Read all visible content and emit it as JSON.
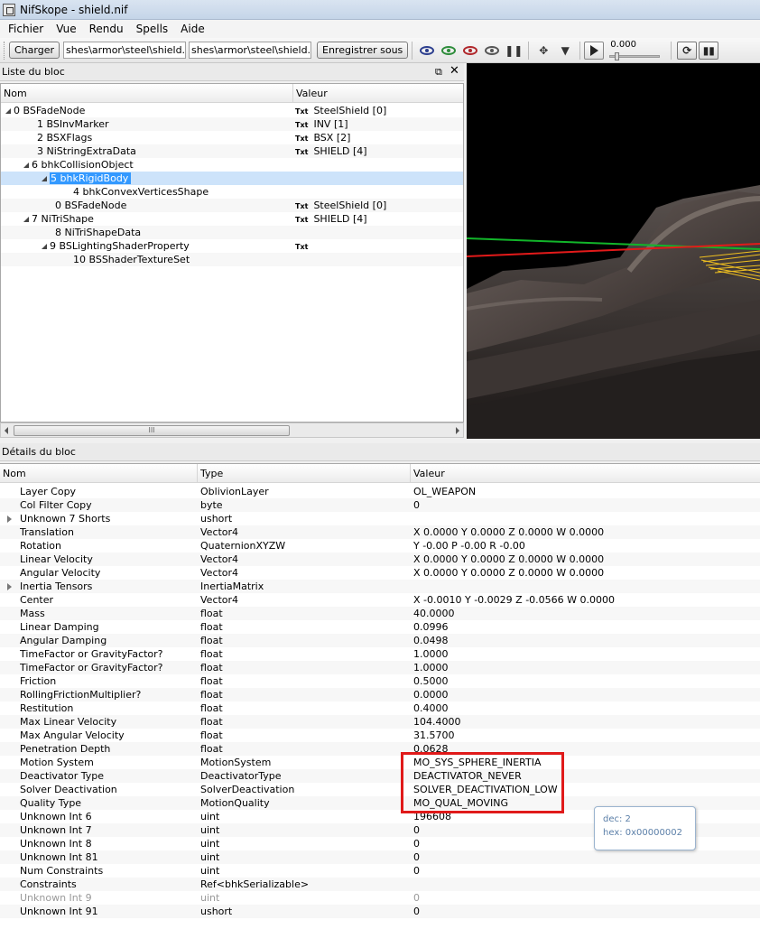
{
  "window": {
    "title": "NifSkope - shield.nif"
  },
  "menu": [
    "Fichier",
    "Vue",
    "Rendu",
    "Spells",
    "Aide"
  ],
  "toolbar": {
    "load_label": "Charger",
    "load_path": "shes\\armor\\steel\\shield.nif",
    "save_path": "shes\\armor\\steel\\shield.nif",
    "save_label": "Enregistrer sous",
    "time_value": "0.000"
  },
  "block_list": {
    "title": "Liste du bloc",
    "columns": [
      "Nom",
      "Valeur"
    ],
    "rows": [
      {
        "label": "0 BSFadeNode",
        "value": "SteelShield [0]",
        "txt": "Txt",
        "indent": 0,
        "arrow": "open"
      },
      {
        "label": "1 BSInvMarker",
        "value": "INV [1]",
        "txt": "Txt",
        "indent": 1,
        "arrow": "none"
      },
      {
        "label": "2 BSXFlags",
        "value": "BSX [2]",
        "txt": "Txt",
        "indent": 1,
        "arrow": "none"
      },
      {
        "label": "3 NiStringExtraData",
        "value": "SHIELD [4]",
        "txt": "Txt",
        "indent": 1,
        "arrow": "none"
      },
      {
        "label": "6 bhkCollisionObject",
        "value": "",
        "txt": "",
        "indent": 1,
        "arrow": "open"
      },
      {
        "label": "5 bhkRigidBody",
        "value": "",
        "txt": "",
        "indent": 2,
        "arrow": "open",
        "selected": true
      },
      {
        "label": "4 bhkConvexVerticesShape",
        "value": "",
        "txt": "",
        "indent": 3,
        "arrow": "none"
      },
      {
        "label": "0 BSFadeNode",
        "value": "SteelShield [0]",
        "txt": "Txt",
        "indent": 2,
        "arrow": "none"
      },
      {
        "label": "7 NiTriShape",
        "value": "SHIELD [4]",
        "txt": "Txt",
        "indent": 1,
        "arrow": "open"
      },
      {
        "label": "8 NiTriShapeData",
        "value": "",
        "txt": "",
        "indent": 2,
        "arrow": "none"
      },
      {
        "label": "9 BSLightingShaderProperty",
        "value": "",
        "txt": "Txt",
        "indent": 2,
        "arrow": "open"
      },
      {
        "label": "10 BSShaderTextureSet",
        "value": "",
        "txt": "",
        "indent": 3,
        "arrow": "none"
      }
    ]
  },
  "scroll_grip": "III",
  "details": {
    "title": "Détails du bloc",
    "columns": [
      "Nom",
      "Type",
      "Valeur"
    ],
    "rows": [
      {
        "name": "Layer Copy",
        "type": "OblivionLayer",
        "value": "OL_WEAPON"
      },
      {
        "name": "Col Filter Copy",
        "type": "byte",
        "value": "0"
      },
      {
        "name": "Unknown 7 Shorts",
        "type": "ushort",
        "value": "",
        "expandable": true
      },
      {
        "name": "Translation",
        "type": "Vector4",
        "value": "X 0.0000 Y 0.0000 Z 0.0000 W 0.0000"
      },
      {
        "name": "Rotation",
        "type": "QuaternionXYZW",
        "value": "Y -0.00 P -0.00 R -0.00"
      },
      {
        "name": "Linear Velocity",
        "type": "Vector4",
        "value": "X 0.0000 Y 0.0000 Z 0.0000 W 0.0000"
      },
      {
        "name": "Angular Velocity",
        "type": "Vector4",
        "value": "X 0.0000 Y 0.0000 Z 0.0000 W 0.0000"
      },
      {
        "name": "Inertia Tensors",
        "type": "InertiaMatrix",
        "value": "",
        "expandable": true
      },
      {
        "name": "Center",
        "type": "Vector4",
        "value": "X -0.0010 Y -0.0029 Z -0.0566 W 0.0000"
      },
      {
        "name": "Mass",
        "type": "float",
        "value": "40.0000"
      },
      {
        "name": "Linear Damping",
        "type": "float",
        "value": "0.0996"
      },
      {
        "name": "Angular Damping",
        "type": "float",
        "value": "0.0498"
      },
      {
        "name": "TimeFactor or GravityFactor?",
        "type": "float",
        "value": "1.0000"
      },
      {
        "name": "TimeFactor or GravityFactor?",
        "type": "float",
        "value": "1.0000"
      },
      {
        "name": "Friction",
        "type": "float",
        "value": "0.5000"
      },
      {
        "name": "RollingFrictionMultiplier?",
        "type": "float",
        "value": "0.0000"
      },
      {
        "name": "Restitution",
        "type": "float",
        "value": "0.4000"
      },
      {
        "name": "Max Linear Velocity",
        "type": "float",
        "value": "104.4000"
      },
      {
        "name": "Max Angular Velocity",
        "type": "float",
        "value": "31.5700"
      },
      {
        "name": "Penetration Depth",
        "type": "float",
        "value": "0.0628"
      },
      {
        "name": "Motion System",
        "type": "MotionSystem",
        "value": "MO_SYS_SPHERE_INERTIA"
      },
      {
        "name": "Deactivator Type",
        "type": "DeactivatorType",
        "value": "DEACTIVATOR_NEVER"
      },
      {
        "name": "Solver Deactivation",
        "type": "SolverDeactivation",
        "value": "SOLVER_DEACTIVATION_LOW"
      },
      {
        "name": "Quality Type",
        "type": "MotionQuality",
        "value": "MO_QUAL_MOVING"
      },
      {
        "name": "Unknown Int 6",
        "type": "uint",
        "value": "196608"
      },
      {
        "name": "Unknown Int 7",
        "type": "uint",
        "value": "0"
      },
      {
        "name": "Unknown Int 8",
        "type": "uint",
        "value": "0"
      },
      {
        "name": "Unknown Int 81",
        "type": "uint",
        "value": "0"
      },
      {
        "name": "Num Constraints",
        "type": "uint",
        "value": "0"
      },
      {
        "name": "Constraints",
        "type": "Ref<bhkSerializable>",
        "value": ""
      },
      {
        "name": "Unknown Int 9",
        "type": "uint",
        "value": "0",
        "disabled": true
      },
      {
        "name": "Unknown Int 91",
        "type": "ushort",
        "value": "0"
      }
    ]
  },
  "tooltip": {
    "line1": "dec: 2",
    "line2": "hex: 0x00000002"
  },
  "colors": {
    "selection": "#3399ff",
    "highlight_box": "#e01a1a",
    "tooltip_text": "#5b7fa8"
  }
}
